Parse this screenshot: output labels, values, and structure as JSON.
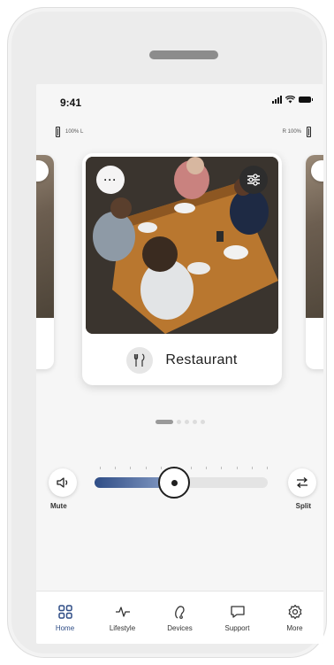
{
  "status": {
    "time": "9:41"
  },
  "hearing": {
    "left_label": "100% L",
    "right_label": "R 100%"
  },
  "program": {
    "name": "Restaurant",
    "more_label": "···",
    "icon": "cutlery-icon"
  },
  "pager": {
    "count": 5,
    "active": 0
  },
  "volume": {
    "mute_label": "Mute",
    "split_label": "Split",
    "level": 0.46
  },
  "tabs": [
    {
      "label": "Home",
      "icon": "home-grid-icon",
      "active": true
    },
    {
      "label": "Lifestyle",
      "icon": "activity-icon",
      "active": false
    },
    {
      "label": "Devices",
      "icon": "hearing-aid-icon",
      "active": false
    },
    {
      "label": "Support",
      "icon": "chat-icon",
      "active": false
    },
    {
      "label": "More",
      "icon": "gear-icon",
      "active": false
    }
  ],
  "colors": {
    "accent": "#2f4d86",
    "track": "#e4e4e4",
    "screen_bg": "#f6f6f6"
  }
}
